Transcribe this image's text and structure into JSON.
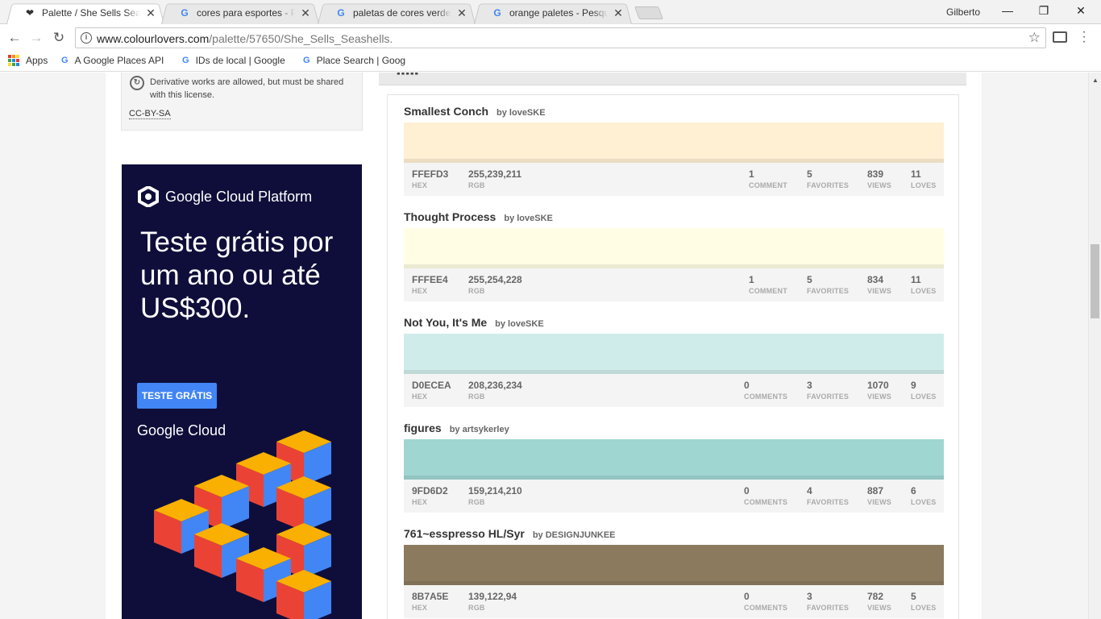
{
  "browser": {
    "tabs": [
      {
        "title": "Palette / She Sells Seashells",
        "icon": "heart-icon",
        "active": true
      },
      {
        "title": "cores para esportes - Pesquisa Google",
        "icon": "google-icon",
        "active": false
      },
      {
        "title": "paletas de cores verdes - Pesquisa Google",
        "icon": "google-icon",
        "active": false
      },
      {
        "title": "orange paletes - Pesquisa Google",
        "icon": "google-icon",
        "active": false
      }
    ],
    "user": "Gilberto",
    "url_host": "www.colourlovers.com",
    "url_path": "/palette/57650/She_Sells_Seashells."
  },
  "bookmarks": [
    {
      "label": "Apps",
      "icon": "apps-grid-icon"
    },
    {
      "label": "A Google Places API V",
      "icon": "google-icon"
    },
    {
      "label": "IDs de local  |  Google",
      "icon": "google-icon"
    },
    {
      "label": "Place Search  |  Goog",
      "icon": "google-icon"
    }
  ],
  "license": {
    "text": "Derivative works are allowed, but must be shared with this license.",
    "code": "CC-BY-SA"
  },
  "ad": {
    "brand": "Google Cloud Platform",
    "headline": "Teste grátis por um ano ou até US$300.",
    "cta": "TESTE GRÁTIS",
    "footer_brand": "Google Cloud",
    "colors": {
      "bg": "#0f0e3a",
      "cta": "#4285f4"
    }
  },
  "labels": {
    "hex": "HEX",
    "rgb": "RGB",
    "comment": "COMMENT",
    "comments": "COMMENTS",
    "favorites": "FAVORITES",
    "views": "VIEWS",
    "loves": "LOVES"
  },
  "colors": [
    {
      "name": "Smallest Conch",
      "by": "by loveSKE",
      "hex": "FFEFD3",
      "rgb": "255,239,211",
      "swatch": "#FFEFD3",
      "comments": "1",
      "comment_label": "COMMENT",
      "favorites": "5",
      "views": "839",
      "loves": "11"
    },
    {
      "name": "Thought Process",
      "by": "by loveSKE",
      "hex": "FFFEE4",
      "rgb": "255,254,228",
      "swatch": "#FFFEE4",
      "comments": "1",
      "comment_label": "COMMENT",
      "favorites": "5",
      "views": "834",
      "loves": "11"
    },
    {
      "name": "Not You, It's Me",
      "by": "by loveSKE",
      "hex": "D0ECEA",
      "rgb": "208,236,234",
      "swatch": "#D0ECEA",
      "comments": "0",
      "comment_label": "COMMENTS",
      "favorites": "3",
      "views": "1070",
      "loves": "9"
    },
    {
      "name": "figures",
      "by": "by artsykerley",
      "hex": "9FD6D2",
      "rgb": "159,214,210",
      "swatch": "#9FD6D2",
      "comments": "0",
      "comment_label": "COMMENTS",
      "favorites": "4",
      "views": "887",
      "loves": "6"
    },
    {
      "name": "761~esspresso HL/Syr",
      "by": "by DESIGNJUNKEE",
      "hex": "8B7A5E",
      "rgb": "139,122,94",
      "swatch": "#8B7A5E",
      "comments": "0",
      "comment_label": "COMMENTS",
      "favorites": "3",
      "views": "782",
      "loves": "5"
    }
  ]
}
